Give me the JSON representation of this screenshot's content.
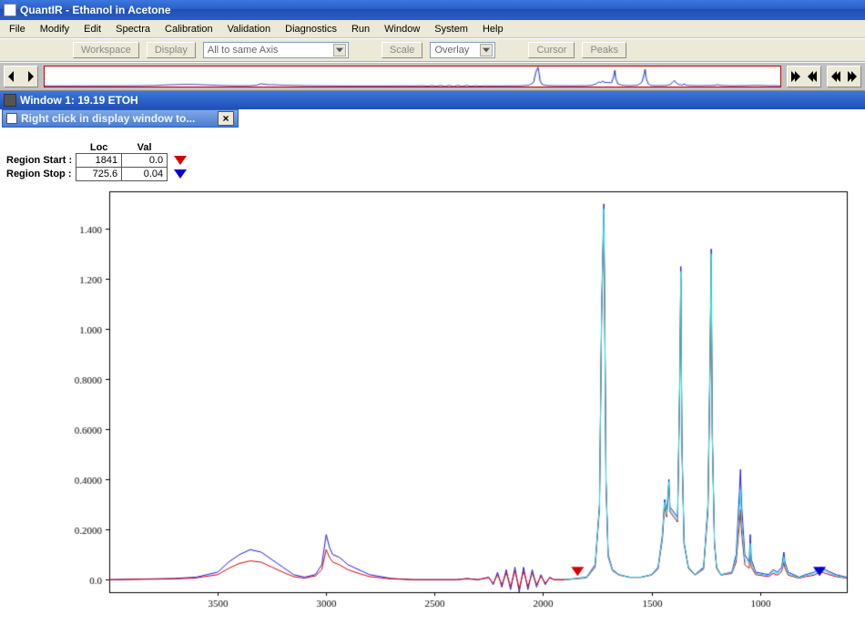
{
  "title": "QuantIR - Ethanol in Acetone",
  "menus": [
    "File",
    "Modify",
    "Edit",
    "Spectra",
    "Calibration",
    "Validation",
    "Diagnostics",
    "Run",
    "Window",
    "System",
    "Help"
  ],
  "toolbar": {
    "workspace": "Workspace",
    "display": "Display",
    "axis_mode": "All to same Axis",
    "scale": "Scale",
    "overlay": "Overlay",
    "cursor": "Cursor",
    "peaks": "Peaks"
  },
  "inner_window_title": "Window 1: 19.19 ETOH",
  "hint_text": "Right click in display window to...",
  "region": {
    "col_loc": "Loc",
    "col_val": "Val",
    "start_label": "Region Start :",
    "stop_label": "Region Stop :",
    "start_loc": "1841",
    "start_val": "0.0",
    "stop_loc": "725.6",
    "stop_val": "0.04"
  },
  "chart_data": {
    "type": "line",
    "title": "",
    "xlabel": "",
    "ylabel": "",
    "x_range": [
      4000,
      600
    ],
    "y_range": [
      -0.05,
      1.55
    ],
    "y_ticks": [
      0.0,
      0.2,
      0.4,
      0.6,
      0.8,
      1.0,
      1.2,
      1.4
    ],
    "y_tick_labels": [
      "0.0",
      "0.2000",
      "0.4000",
      "0.6000",
      "0.8000",
      "1.000",
      "1.200",
      "1.400"
    ],
    "x_ticks": [
      3500,
      3000,
      2500,
      2000,
      1500,
      1000
    ],
    "marker_red_x": 1841,
    "marker_blue_x": 725.6,
    "series": [
      {
        "name": "trace-blue",
        "color": "#1a1ae6",
        "points": [
          [
            4000,
            0.0
          ],
          [
            3700,
            0.005
          ],
          [
            3600,
            0.01
          ],
          [
            3500,
            0.03
          ],
          [
            3450,
            0.07
          ],
          [
            3400,
            0.1
          ],
          [
            3350,
            0.12
          ],
          [
            3300,
            0.11
          ],
          [
            3250,
            0.08
          ],
          [
            3200,
            0.05
          ],
          [
            3150,
            0.02
          ],
          [
            3100,
            0.01
          ],
          [
            3050,
            0.02
          ],
          [
            3020,
            0.06
          ],
          [
            3000,
            0.18
          ],
          [
            2985,
            0.13
          ],
          [
            2970,
            0.1
          ],
          [
            2940,
            0.09
          ],
          [
            2900,
            0.06
          ],
          [
            2850,
            0.04
          ],
          [
            2800,
            0.02
          ],
          [
            2700,
            0.005
          ],
          [
            2600,
            0.0
          ],
          [
            2500,
            0.0
          ],
          [
            2400,
            0.0
          ],
          [
            2350,
            0.005
          ],
          [
            2300,
            0.0
          ],
          [
            2250,
            0.01
          ],
          [
            2230,
            -0.02
          ],
          [
            2210,
            0.03
          ],
          [
            2190,
            -0.03
          ],
          [
            2170,
            0.04
          ],
          [
            2150,
            -0.04
          ],
          [
            2130,
            0.05
          ],
          [
            2110,
            -0.05
          ],
          [
            2090,
            0.05
          ],
          [
            2070,
            -0.04
          ],
          [
            2050,
            0.04
          ],
          [
            2030,
            -0.03
          ],
          [
            2010,
            0.02
          ],
          [
            1990,
            -0.02
          ],
          [
            1970,
            0.01
          ],
          [
            1950,
            0.0
          ],
          [
            1900,
            0.0
          ],
          [
            1850,
            0.005
          ],
          [
            1800,
            0.01
          ],
          [
            1760,
            0.06
          ],
          [
            1740,
            0.3
          ],
          [
            1730,
            1.1
          ],
          [
            1720,
            1.5
          ],
          [
            1715,
            1.0
          ],
          [
            1710,
            0.4
          ],
          [
            1700,
            0.1
          ],
          [
            1680,
            0.04
          ],
          [
            1650,
            0.02
          ],
          [
            1600,
            0.01
          ],
          [
            1550,
            0.01
          ],
          [
            1500,
            0.02
          ],
          [
            1470,
            0.05
          ],
          [
            1450,
            0.18
          ],
          [
            1440,
            0.32
          ],
          [
            1430,
            0.27
          ],
          [
            1420,
            0.4
          ],
          [
            1415,
            0.29
          ],
          [
            1380,
            0.25
          ],
          [
            1370,
            0.8
          ],
          [
            1365,
            1.25
          ],
          [
            1360,
            0.55
          ],
          [
            1350,
            0.15
          ],
          [
            1330,
            0.05
          ],
          [
            1300,
            0.02
          ],
          [
            1260,
            0.05
          ],
          [
            1240,
            0.3
          ],
          [
            1230,
            0.9
          ],
          [
            1225,
            1.32
          ],
          [
            1220,
            0.6
          ],
          [
            1210,
            0.15
          ],
          [
            1200,
            0.05
          ],
          [
            1180,
            0.02
          ],
          [
            1130,
            0.03
          ],
          [
            1110,
            0.1
          ],
          [
            1095,
            0.35
          ],
          [
            1090,
            0.44
          ],
          [
            1085,
            0.3
          ],
          [
            1070,
            0.1
          ],
          [
            1050,
            0.07
          ],
          [
            1045,
            0.18
          ],
          [
            1040,
            0.08
          ],
          [
            1020,
            0.03
          ],
          [
            960,
            0.02
          ],
          [
            940,
            0.04
          ],
          [
            920,
            0.03
          ],
          [
            900,
            0.05
          ],
          [
            890,
            0.11
          ],
          [
            885,
            0.07
          ],
          [
            870,
            0.03
          ],
          [
            820,
            0.01
          ],
          [
            790,
            0.02
          ],
          [
            750,
            0.03
          ],
          [
            720,
            0.05
          ],
          [
            700,
            0.04
          ],
          [
            650,
            0.02
          ],
          [
            600,
            0.01
          ]
        ]
      },
      {
        "name": "trace-red",
        "color": "#d40000",
        "points": [
          [
            4000,
            0.0
          ],
          [
            3700,
            0.003
          ],
          [
            3600,
            0.007
          ],
          [
            3500,
            0.02
          ],
          [
            3450,
            0.045
          ],
          [
            3400,
            0.065
          ],
          [
            3350,
            0.075
          ],
          [
            3300,
            0.07
          ],
          [
            3250,
            0.05
          ],
          [
            3200,
            0.03
          ],
          [
            3150,
            0.012
          ],
          [
            3100,
            0.006
          ],
          [
            3050,
            0.015
          ],
          [
            3020,
            0.04
          ],
          [
            3000,
            0.12
          ],
          [
            2985,
            0.09
          ],
          [
            2970,
            0.07
          ],
          [
            2940,
            0.06
          ],
          [
            2900,
            0.04
          ],
          [
            2850,
            0.025
          ],
          [
            2800,
            0.012
          ],
          [
            2700,
            0.003
          ],
          [
            2600,
            0.0
          ],
          [
            2500,
            0.0
          ],
          [
            2400,
            0.0
          ],
          [
            2350,
            0.003
          ],
          [
            2300,
            0.0
          ],
          [
            2250,
            0.008
          ],
          [
            2230,
            -0.015
          ],
          [
            2210,
            0.02
          ],
          [
            2190,
            -0.02
          ],
          [
            2170,
            0.028
          ],
          [
            2150,
            -0.028
          ],
          [
            2130,
            0.035
          ],
          [
            2110,
            -0.035
          ],
          [
            2090,
            0.035
          ],
          [
            2070,
            -0.028
          ],
          [
            2050,
            0.028
          ],
          [
            2030,
            -0.02
          ],
          [
            2010,
            0.014
          ],
          [
            1990,
            -0.014
          ],
          [
            1970,
            0.007
          ],
          [
            1950,
            0.0
          ],
          [
            1900,
            0.0
          ],
          [
            1850,
            0.003
          ],
          [
            1800,
            0.007
          ],
          [
            1760,
            0.05
          ],
          [
            1740,
            0.28
          ],
          [
            1730,
            1.05
          ],
          [
            1720,
            1.45
          ],
          [
            1715,
            0.95
          ],
          [
            1710,
            0.38
          ],
          [
            1700,
            0.09
          ],
          [
            1680,
            0.035
          ],
          [
            1650,
            0.018
          ],
          [
            1600,
            0.009
          ],
          [
            1550,
            0.009
          ],
          [
            1500,
            0.018
          ],
          [
            1470,
            0.042
          ],
          [
            1450,
            0.16
          ],
          [
            1440,
            0.29
          ],
          [
            1430,
            0.25
          ],
          [
            1420,
            0.37
          ],
          [
            1415,
            0.27
          ],
          [
            1380,
            0.23
          ],
          [
            1370,
            0.75
          ],
          [
            1365,
            1.2
          ],
          [
            1360,
            0.52
          ],
          [
            1350,
            0.14
          ],
          [
            1330,
            0.045
          ],
          [
            1300,
            0.018
          ],
          [
            1260,
            0.042
          ],
          [
            1240,
            0.27
          ],
          [
            1230,
            0.85
          ],
          [
            1225,
            1.28
          ],
          [
            1220,
            0.57
          ],
          [
            1210,
            0.14
          ],
          [
            1200,
            0.045
          ],
          [
            1180,
            0.018
          ],
          [
            1130,
            0.025
          ],
          [
            1110,
            0.07
          ],
          [
            1095,
            0.22
          ],
          [
            1090,
            0.28
          ],
          [
            1085,
            0.19
          ],
          [
            1070,
            0.06
          ],
          [
            1050,
            0.045
          ],
          [
            1045,
            0.11
          ],
          [
            1040,
            0.05
          ],
          [
            1020,
            0.02
          ],
          [
            960,
            0.012
          ],
          [
            940,
            0.025
          ],
          [
            920,
            0.018
          ],
          [
            900,
            0.032
          ],
          [
            890,
            0.07
          ],
          [
            885,
            0.045
          ],
          [
            870,
            0.018
          ],
          [
            820,
            0.006
          ],
          [
            790,
            0.012
          ],
          [
            750,
            0.018
          ],
          [
            720,
            0.032
          ],
          [
            700,
            0.025
          ],
          [
            650,
            0.012
          ],
          [
            600,
            0.006
          ]
        ]
      },
      {
        "name": "trace-cyan",
        "color": "#22e6e6",
        "points": [
          [
            1900,
            0.0
          ],
          [
            1850,
            0.004
          ],
          [
            1800,
            0.008
          ],
          [
            1760,
            0.055
          ],
          [
            1740,
            0.29
          ],
          [
            1730,
            1.08
          ],
          [
            1720,
            1.48
          ],
          [
            1715,
            0.98
          ],
          [
            1710,
            0.39
          ],
          [
            1700,
            0.095
          ],
          [
            1680,
            0.037
          ],
          [
            1650,
            0.019
          ],
          [
            1600,
            0.0095
          ],
          [
            1550,
            0.0095
          ],
          [
            1500,
            0.019
          ],
          [
            1470,
            0.045
          ],
          [
            1450,
            0.17
          ],
          [
            1440,
            0.31
          ],
          [
            1430,
            0.26
          ],
          [
            1420,
            0.39
          ],
          [
            1415,
            0.28
          ],
          [
            1380,
            0.24
          ],
          [
            1370,
            0.78
          ],
          [
            1365,
            1.23
          ],
          [
            1360,
            0.54
          ],
          [
            1350,
            0.145
          ],
          [
            1330,
            0.048
          ],
          [
            1300,
            0.019
          ],
          [
            1260,
            0.045
          ],
          [
            1240,
            0.29
          ],
          [
            1230,
            0.88
          ],
          [
            1225,
            1.3
          ],
          [
            1220,
            0.585
          ],
          [
            1210,
            0.145
          ],
          [
            1200,
            0.048
          ],
          [
            1180,
            0.019
          ],
          [
            1130,
            0.028
          ],
          [
            1110,
            0.085
          ],
          [
            1095,
            0.28
          ],
          [
            1090,
            0.36
          ],
          [
            1085,
            0.24
          ],
          [
            1070,
            0.08
          ],
          [
            1050,
            0.06
          ],
          [
            1045,
            0.145
          ],
          [
            1040,
            0.065
          ],
          [
            1020,
            0.025
          ],
          [
            960,
            0.016
          ],
          [
            940,
            0.032
          ],
          [
            920,
            0.024
          ],
          [
            900,
            0.04
          ],
          [
            890,
            0.09
          ],
          [
            885,
            0.06
          ],
          [
            870,
            0.024
          ],
          [
            820,
            0.008
          ],
          [
            790,
            0.016
          ],
          [
            750,
            0.022
          ],
          [
            720,
            0.04
          ],
          [
            700,
            0.032
          ],
          [
            650,
            0.016
          ],
          [
            600,
            0.008
          ]
        ]
      }
    ]
  }
}
